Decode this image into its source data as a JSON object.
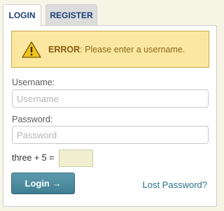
{
  "tabs": {
    "login": "LOGIN",
    "register": "REGISTER"
  },
  "error": {
    "prefix": "ERROR",
    "message": ": Please enter a username."
  },
  "form": {
    "username_label": "Username:",
    "username_placeholder": "Username",
    "username_value": "",
    "password_label": "Password:",
    "password_placeholder": "Password",
    "password_value": "",
    "captcha_label": "three + 5 =",
    "captcha_value": ""
  },
  "actions": {
    "login_label": "Login →",
    "lost_password_label": "Lost Password?"
  },
  "colors": {
    "error_bg": "#fbe7a0",
    "button": "#4a8ba0",
    "link": "#2d6f8c"
  }
}
